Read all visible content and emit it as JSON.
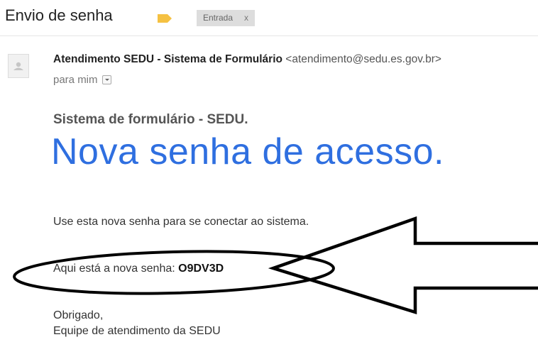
{
  "header": {
    "subject": "Envio de senha",
    "label_icon": "label-tag-icon",
    "label_color": "#f5c142",
    "label_name": "Entrada",
    "label_remove": "x"
  },
  "message": {
    "avatar_icon": "person-icon",
    "sender_name": "Atendimento SEDU - Sistema de Formulário",
    "sender_email": "<atendimento@sedu.es.gov.br>",
    "recipient": "para mim",
    "details_icon": "chevron-down-icon"
  },
  "body": {
    "system_title": "Sistema de formulário - SEDU.",
    "headline": "Nova senha de acesso.",
    "instruction": "Use esta nova senha para se conectar ao sistema.",
    "password_label": "Aqui está a nova senha:",
    "password_value": "O9DV3D",
    "thanks": "Obrigado,",
    "signature": "Equipe de atendimento da SEDU"
  },
  "colors": {
    "headline": "#2f6fe0",
    "annotation_ink": "#000000"
  }
}
